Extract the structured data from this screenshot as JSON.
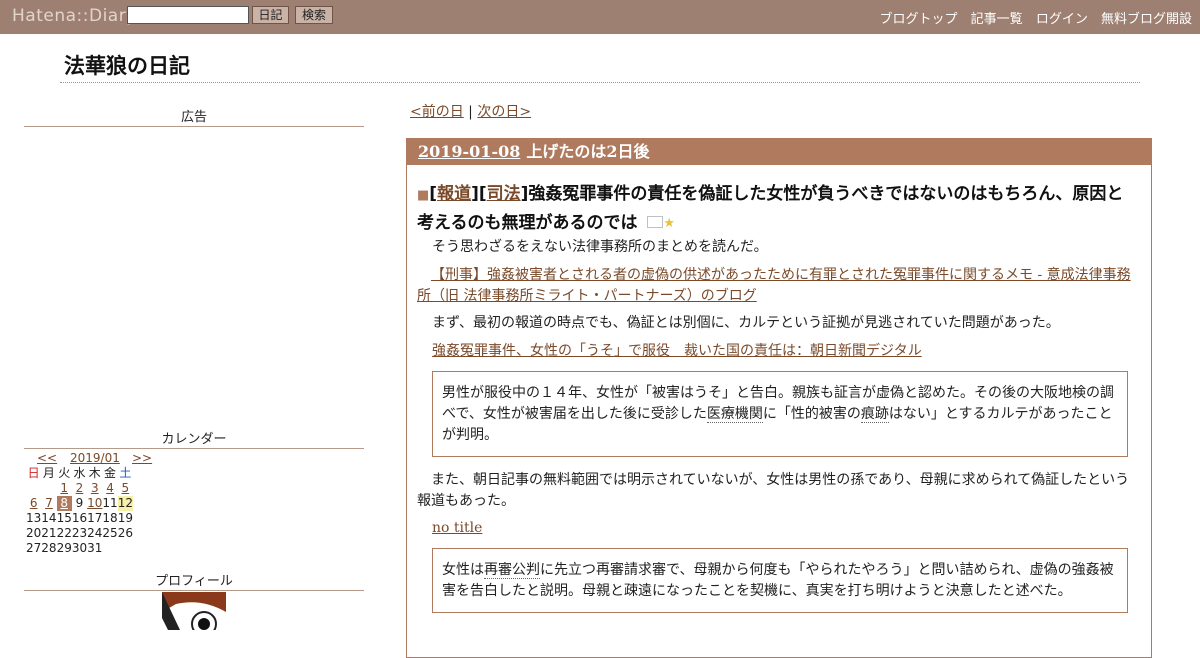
{
  "topbar": {
    "logo": "Hatena::Diary",
    "search_value": "",
    "diary_button": "日記",
    "search_button": "検索",
    "links": [
      "ブログトップ",
      "記事一覧",
      "ログイン",
      "無料ブログ開設"
    ]
  },
  "blog": {
    "title": "法華狼の日記"
  },
  "sidebar": {
    "ad_heading": "広告",
    "calendar_heading": "カレンダー",
    "profile_heading": "プロフィール",
    "calendar": {
      "prev": "<<",
      "month": "2019/01",
      "next": ">>",
      "weekdays": [
        "日",
        "月",
        "火",
        "水",
        "木",
        "金",
        "土"
      ],
      "weeks": [
        [
          "",
          "",
          "1",
          "2",
          "3",
          "4",
          "5"
        ],
        [
          "6",
          "7",
          "8",
          "9",
          "10",
          "11",
          "12"
        ],
        [
          "13",
          "14",
          "15",
          "16",
          "17",
          "18",
          "19"
        ],
        [
          "20",
          "21",
          "22",
          "23",
          "24",
          "25",
          "26"
        ],
        [
          "27",
          "28",
          "29",
          "30",
          "31",
          "",
          ""
        ]
      ],
      "linked_days": [
        "1",
        "2",
        "3",
        "4",
        "5",
        "6",
        "7",
        "8",
        "10"
      ],
      "selected_day": "8",
      "today": "12"
    }
  },
  "main": {
    "prev_day": "<前の日",
    "nav_sep": " | ",
    "next_day": "次の日>",
    "day": {
      "date": "2019-01-08",
      "title": "上げたのは2日後"
    },
    "section": {
      "marker": "■",
      "cat_open": "[",
      "cat_mid": "][",
      "cat_close": "]",
      "cat1": "報道",
      "cat2": "司法",
      "title": "強姦冤罪事件の責任を偽証した女性が負うべきではないのはもちろん、原因と考えるのも無理があるのでは",
      "star": "★"
    },
    "p1": "そう思わざるをえない法律事務所のまとめを読んだ。",
    "link1": "【刑事】強姦被害者とされる者の虚偽の供述があったために有罪とされた冤罪事件に関するメモ - 意成法律事務所（旧 法律事務所ミライト・パートナーズ）のブログ",
    "p2": "まず、最初の報道の時点でも、偽証とは別個に、カルテという証拠が見逃されていた問題があった。",
    "link2": "強姦冤罪事件、女性の「うそ」で服役　裁いた国の責任は：朝日新聞デジタル",
    "quote1": {
      "t1": "男性が服役中の１４年、女性が「被害はうそ」と告白。親族も証言が虚偽と認めた。その後の大阪地検の調べで、女性が被害届を出した後に受診した",
      "k1": "医療機関",
      "t2": "に「性的被害の",
      "k2": "痕跡",
      "t3": "はない」とするカルテがあったことが判明。"
    },
    "p3": "また、朝日記事の無料範囲では明示されていないが、女性は男性の孫であり、母親に求められて偽証したという報道もあった。",
    "link3": "no title",
    "quote2": {
      "t1": "女性は",
      "k1": "再審公判",
      "t2": "に先立つ再審請求審で、母親から何度も「やられたやろう」と問い詰められ、虚偽の強姦被害を告白したと説明。母親と疎遠になったことを契機に、真実を打ち明けようと決意したと述べた。"
    }
  }
}
